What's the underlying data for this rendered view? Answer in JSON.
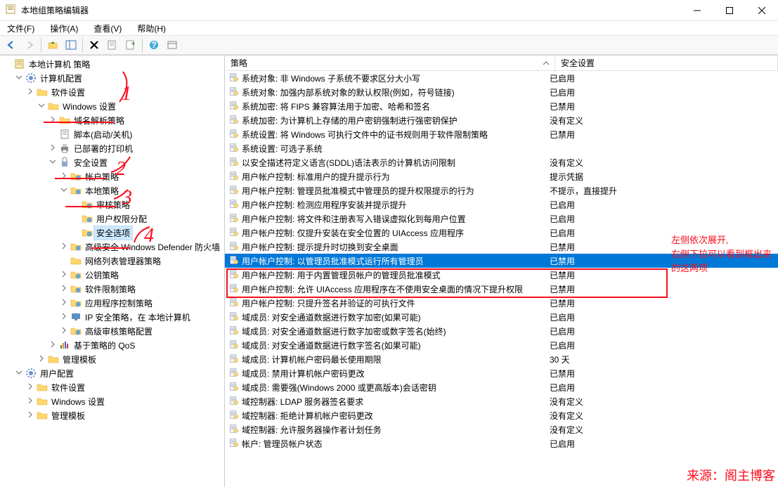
{
  "window": {
    "title": "本地组策略编辑器"
  },
  "menu": {
    "file": "文件(F)",
    "action": "操作(A)",
    "view": "查看(V)",
    "help": "帮助(H)"
  },
  "columns": {
    "policy": "策略",
    "setting": "安全设置"
  },
  "tree": [
    {
      "d": 0,
      "exp": "",
      "ico": "book",
      "label": "本地计算机 策略"
    },
    {
      "d": 1,
      "exp": "v",
      "ico": "gear",
      "label": "计算机配置"
    },
    {
      "d": 2,
      "exp": ">",
      "ico": "folder",
      "label": "软件设置"
    },
    {
      "d": 3,
      "exp": "v",
      "ico": "folder",
      "label": "Windows 设置"
    },
    {
      "d": 4,
      "exp": ">",
      "ico": "folder",
      "label": "域名解析策略"
    },
    {
      "d": 4,
      "exp": "",
      "ico": "script",
      "label": "脚本(启动/关机)"
    },
    {
      "d": 4,
      "exp": ">",
      "ico": "printer",
      "label": "已部署的打印机"
    },
    {
      "d": 4,
      "exp": "v",
      "ico": "lock",
      "label": "安全设置"
    },
    {
      "d": 5,
      "exp": ">",
      "ico": "folder2",
      "label": "帐户策略"
    },
    {
      "d": 5,
      "exp": "v",
      "ico": "folder2",
      "label": "本地策略"
    },
    {
      "d": 6,
      "exp": "",
      "ico": "folder2",
      "label": "审核策略"
    },
    {
      "d": 6,
      "exp": "",
      "ico": "folder2",
      "label": "用户权限分配"
    },
    {
      "d": 6,
      "exp": "",
      "ico": "folder2",
      "label": "安全选项",
      "sel": true
    },
    {
      "d": 5,
      "exp": ">",
      "ico": "folder2",
      "label": "高级安全 Windows Defender 防火墙"
    },
    {
      "d": 5,
      "exp": "",
      "ico": "folder",
      "label": "网络列表管理器策略"
    },
    {
      "d": 5,
      "exp": ">",
      "ico": "folder2",
      "label": "公钥策略"
    },
    {
      "d": 5,
      "exp": ">",
      "ico": "folder2",
      "label": "软件限制策略"
    },
    {
      "d": 5,
      "exp": ">",
      "ico": "folder2",
      "label": "应用程序控制策略"
    },
    {
      "d": 5,
      "exp": ">",
      "ico": "ip",
      "label": "IP 安全策略，在 本地计算机"
    },
    {
      "d": 5,
      "exp": ">",
      "ico": "folder2",
      "label": "高级审核策略配置"
    },
    {
      "d": 4,
      "exp": ">",
      "ico": "qos",
      "label": "基于策略的 QoS"
    },
    {
      "d": 3,
      "exp": ">",
      "ico": "folder",
      "label": "管理模板"
    },
    {
      "d": 1,
      "exp": "v",
      "ico": "gear",
      "label": "用户配置"
    },
    {
      "d": 2,
      "exp": ">",
      "ico": "folder",
      "label": "软件设置"
    },
    {
      "d": 2,
      "exp": ">",
      "ico": "folder",
      "label": "Windows 设置"
    },
    {
      "d": 2,
      "exp": ">",
      "ico": "folder",
      "label": "管理模板"
    }
  ],
  "policies": [
    {
      "name": "系统对象: 非 Windows 子系统不要求区分大小写",
      "val": "已启用"
    },
    {
      "name": "系统对象: 加强内部系统对象的默认权限(例如，符号链接)",
      "val": "已启用"
    },
    {
      "name": "系统加密: 将 FIPS 兼容算法用于加密、哈希和签名",
      "val": "已禁用"
    },
    {
      "name": "系统加密: 为计算机上存储的用户密钥强制进行强密钥保护",
      "val": "没有定义"
    },
    {
      "name": "系统设置: 将 Windows 可执行文件中的证书规则用于软件限制策略",
      "val": "已禁用"
    },
    {
      "name": "系统设置: 可选子系统",
      "val": ""
    },
    {
      "name": "以安全描述符定义语言(SDDL)语法表示的计算机访问限制",
      "val": "没有定义"
    },
    {
      "name": "用户帐户控制: 标准用户的提升提示行为",
      "val": "提示凭据"
    },
    {
      "name": "用户帐户控制: 管理员批准模式中管理员的提升权限提示的行为",
      "val": "不提示，直接提升"
    },
    {
      "name": "用户帐户控制: 检测应用程序安装并提示提升",
      "val": "已启用"
    },
    {
      "name": "用户帐户控制: 将文件和注册表写入错误虚拟化到每用户位置",
      "val": "已启用"
    },
    {
      "name": "用户帐户控制: 仅提升安装在安全位置的 UIAccess 应用程序",
      "val": "已启用"
    },
    {
      "name": "用户帐户控制: 提示提升时切换到安全桌面",
      "val": "已禁用"
    },
    {
      "name": "用户帐户控制: 以管理员批准模式运行所有管理员",
      "val": "已禁用",
      "sel": true
    },
    {
      "name": "用户帐户控制: 用于内置管理员帐户的管理员批准模式",
      "val": "已禁用"
    },
    {
      "name": "用户帐户控制: 允许 UIAccess 应用程序在不使用安全桌面的情况下提升权限",
      "val": "已禁用"
    },
    {
      "name": "用户帐户控制: 只提升签名并验证的可执行文件",
      "val": "已禁用"
    },
    {
      "name": "域成员: 对安全通道数据进行数字加密(如果可能)",
      "val": "已启用"
    },
    {
      "name": "域成员: 对安全通道数据进行数字加密或数字签名(始终)",
      "val": "已启用"
    },
    {
      "name": "域成员: 对安全通道数据进行数字签名(如果可能)",
      "val": "已启用"
    },
    {
      "name": "域成员: 计算机帐户密码最长使用期限",
      "val": "30 天"
    },
    {
      "name": "域成员: 禁用计算机帐户密码更改",
      "val": "已禁用"
    },
    {
      "name": "域成员: 需要强(Windows 2000 或更高版本)会话密钥",
      "val": "已启用"
    },
    {
      "name": "域控制器: LDAP 服务器签名要求",
      "val": "没有定义"
    },
    {
      "name": "域控制器: 拒绝计算机帐户密码更改",
      "val": "没有定义"
    },
    {
      "name": "域控制器: 允许服务器操作者计划任务",
      "val": "没有定义"
    },
    {
      "name": "帐户: 管理员帐户状态",
      "val": "已启用"
    }
  ],
  "annotations": {
    "note": "左侧依次展开,右侧下拉可以看到框出来的这两项",
    "source": "来源：阁主博客"
  }
}
